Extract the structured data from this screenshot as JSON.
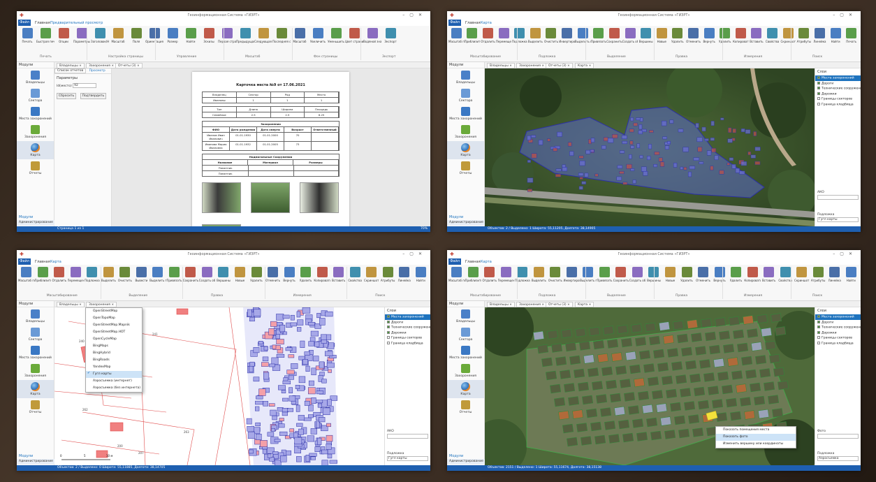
{
  "colors": {
    "accent": "#1e73be",
    "status_bar": "#1e5fb0",
    "plot_outline": "#2b2fa8",
    "plot_fill": "#a7a8e8",
    "paper_map_lines": "#e04a4a",
    "photo_highlight": "#f4e23c"
  },
  "windows": [
    {
      "title": "Геоинформационная Система «ГИЗРТ»",
      "file_tab": "Файл",
      "tabs": [
        "Главная",
        "Предварительный просмотр"
      ],
      "ribbon": {
        "buttons": [
          "Печать",
          "Быстрая печать",
          "Опции",
          "Параметры",
          "Заголовок/Нижний колонтитул",
          "Масштаб",
          "Поля",
          "Ориентация",
          "Размер",
          "Найти",
          "Эскизы",
          "Первая страница",
          "Предыдущая страница",
          "Следующая страница",
          "Последняя страница",
          "Масштаб",
          "Увеличить",
          "Уменьшить",
          "Цвет страницы",
          "Водяной знак",
          "Экспорт"
        ],
        "groups": [
          "Печать",
          "Настройка страницы",
          "Управление",
          "Масштаб",
          "Фон страницы",
          "Экспорт"
        ]
      },
      "sidebar": {
        "header": "Модули",
        "items": [
          "Владельцы",
          "Сектора",
          "Места захоронений",
          "Захоронения",
          "Карта",
          "Отчеты"
        ],
        "active": 5,
        "footer": "Модули",
        "admin": "Администрирование"
      },
      "doc_tabs": [
        "Владельцы ×",
        "Захоронения ×",
        "Отчеты (3) ×"
      ],
      "report_panel": {
        "tabs": [
          "Список отчетов",
          "Просмотр"
        ],
        "params_title": "Параметры",
        "id_label": "Id(место)",
        "id_value": "92",
        "btn_reset": "Сбросить",
        "btn_submit": "Подтвердить"
      },
      "report": {
        "title": "Карточка места №9 от 17.06.2021",
        "table1_head": [
          "Владелец",
          "Сектор",
          "Ряд",
          "Место"
        ],
        "table1_row": [
          "Ивановы",
          "1",
          "1",
          "1"
        ],
        "table2_head": [
          "Тип",
          "Длина",
          "Ширина",
          "Площадь"
        ],
        "table2_row": [
          "Семейное",
          "2.5",
          "2.5",
          "6.25"
        ],
        "burials_title": "Захоронения",
        "burials_head": [
          "ФИО",
          "Дата рождения",
          "Дата смерти",
          "Возраст",
          "Ответственный"
        ],
        "burials_rows": [
          [
            "Иванов Иван Иванович",
            "01.01.1930",
            "01.01.2000",
            "70",
            ""
          ],
          [
            "Иванова Мария Ивановна",
            "01.01.1932",
            "01.01.2005",
            "73",
            ""
          ]
        ],
        "struct_title": "Надмогильные Сооружения",
        "struct_head": [
          "Название",
          "Материал",
          "Размеры"
        ],
        "struct_rows": [
          "Памятник",
          "Памятник"
        ]
      },
      "status": {
        "left": "Страница 1 из 1",
        "zoom": "70%"
      }
    },
    {
      "title": "Геоинформационная Система «ГИЗРТ»",
      "file_tab": "Файл",
      "tabs": [
        "Главная",
        "Карта"
      ],
      "ribbon": {
        "buttons": [
          "Масштаб по слою",
          "Приблизить",
          "Отдалить",
          "Перемещение",
          "Подложка",
          "Выделить",
          "Очистить",
          "Инвертировать",
          "Выделить по группе",
          "Привязать",
          "Сохранить",
          "Создать объект",
          "Вершины",
          "Новые",
          "Удалить",
          "Отменить",
          "Вернуть",
          "Удалить",
          "Копировать",
          "Вставить",
          "Свойства",
          "Скриншот",
          "Атрибуты",
          "Линейка",
          "Найти",
          "Печать"
        ],
        "groups": [
          "Масштабирование",
          "Подложка",
          "Выделение",
          "Правка",
          "Измерения",
          "Поиск"
        ]
      },
      "sidebar": {
        "header": "Модули",
        "items": [
          "Владельцы",
          "Сектора",
          "Места захоронений",
          "Захоронения",
          "Карта",
          "Отчеты"
        ],
        "active": 5,
        "footer": "Модули",
        "admin": "Администрирование"
      },
      "doc_tabs": [
        "Владельцы ×",
        "Захоронения ×",
        "Отчеты (3) ×",
        "Карта ×"
      ],
      "layers": {
        "title": "Слои",
        "items": [
          "Места захоронений",
          "Дороги",
          "Технические сооружения",
          "Дорожки",
          "Границы секторов",
          "Граница кладбища"
        ],
        "selected": 0,
        "field1": "АКО",
        "field2": "Подложка",
        "field2_value": "Гугл карты"
      },
      "status": {
        "left": "Объектов: 2 / Выделено: 1   Широта: 55,11205, Долгота: 38,14905"
      }
    },
    {
      "title": "Геоинформационная Система «ГИЗРТ»",
      "file_tab": "Файл",
      "tabs": [
        "Главная",
        "Карта"
      ],
      "ribbon": {
        "buttons": [
          "Масштаб по слою",
          "Приблизить",
          "Отдалить",
          "Перемещение",
          "Подложка",
          "Выделить",
          "Очистить",
          "Вывести",
          "Выделить по группе",
          "Привязать",
          "Сохранить",
          "Создать объект",
          "Вершины",
          "Новые",
          "Удалить",
          "Отменить",
          "Вернуть",
          "Удалить",
          "Копировать",
          "Вставить",
          "Свойства",
          "Скриншот",
          "Атрибуты",
          "Линейка",
          "Найти"
        ],
        "groups": [
          "Масштабирование",
          "Выделение",
          "Правка",
          "Измерения",
          "Поиск"
        ]
      },
      "sidebar": {
        "header": "Модули",
        "items": [
          "Владельцы",
          "Сектора",
          "Места захоронений",
          "Захоронения",
          "Карта",
          "Отчеты"
        ],
        "active": 5,
        "footer": "Модули",
        "admin": "Администрирование"
      },
      "doc_tabs": [
        "Владельцы ×",
        "Захоронения ×"
      ],
      "basemap_menu": {
        "items": [
          "OpenStreetMap",
          "OpenTopoMap",
          "OpenStreetMap.Mapnik",
          "OpenStreetMap.HOT",
          "OpenCycleMap",
          "BingMaps",
          "BingHybrid",
          "BingRoads",
          "YandexMap",
          "Гугл карты",
          "Аэросъемка (интернет)",
          "Аэросъемка (без интернета)"
        ],
        "checked": 9
      },
      "layers": {
        "title": "Слои",
        "items": [
          "Места захоронений",
          "Дороги",
          "Технические сооружения",
          "Дорожки",
          "Границы секторов",
          "Граница кладбища"
        ],
        "selected": 0,
        "field1": "АКО",
        "field2": "Подложка",
        "field2_value": "Гугл карты"
      },
      "plot_labels": [
        "240",
        "241",
        "262",
        "263",
        "200",
        "207"
      ],
      "scale": {
        "zero": "0",
        "mid": "5",
        "end": "10 м"
      },
      "status": {
        "left": "Объектов: 2 / Выделено: 0   Широта: 55,11885, Долгота: 38,14705"
      }
    },
    {
      "title": "Геоинформационная Система «ГИЗРТ»",
      "file_tab": "Файл",
      "tabs": [
        "Главная",
        "Карта"
      ],
      "ribbon": {
        "buttons": [
          "Масштаб по слою",
          "Приблизить",
          "Отдалить",
          "Перемещение",
          "Подложка",
          "Выделить",
          "Очистить",
          "Инвертировать",
          "Выделить по группе",
          "Привязать",
          "Сохранить",
          "Создать объект",
          "Вершины",
          "Новые",
          "Удалить",
          "Отменить",
          "Вернуть",
          "Удалить",
          "Копировать",
          "Вставить",
          "Свойства",
          "Скриншот",
          "Атрибуты",
          "Линейка",
          "Найти"
        ],
        "groups": [
          "Масштабирование",
          "Подложка",
          "Выделение",
          "Правка",
          "Измерения",
          "Поиск"
        ]
      },
      "sidebar": {
        "header": "Модули",
        "items": [
          "Владельцы",
          "Сектора",
          "Места захоронений",
          "Захоронения",
          "Карта",
          "Отчеты"
        ],
        "active": 5,
        "footer": "Модули",
        "admin": "Администрирование"
      },
      "doc_tabs": [
        "Владельцы ×",
        "Захоронения ×",
        "Отчеты (3) ×",
        "Карта ×"
      ],
      "context_menu": {
        "items": [
          "Показать помещения места",
          "Показать фото",
          "Изменить вершину или координаты"
        ],
        "highlight": 1
      },
      "layers": {
        "title": "Слои",
        "items": [
          "Места захоронений",
          "Дороги",
          "Технические сооружения",
          "Дорожки",
          "Границы секторов",
          "Граница кладбища"
        ],
        "selected": 0,
        "field1": "Фото",
        "field2": "Подложка",
        "field2_value": "Аэросъемка"
      },
      "status": {
        "left": "Объектов: 2151 / Выделено: 1   Широта: 55,11674, Долгота: 38,15138"
      }
    }
  ]
}
